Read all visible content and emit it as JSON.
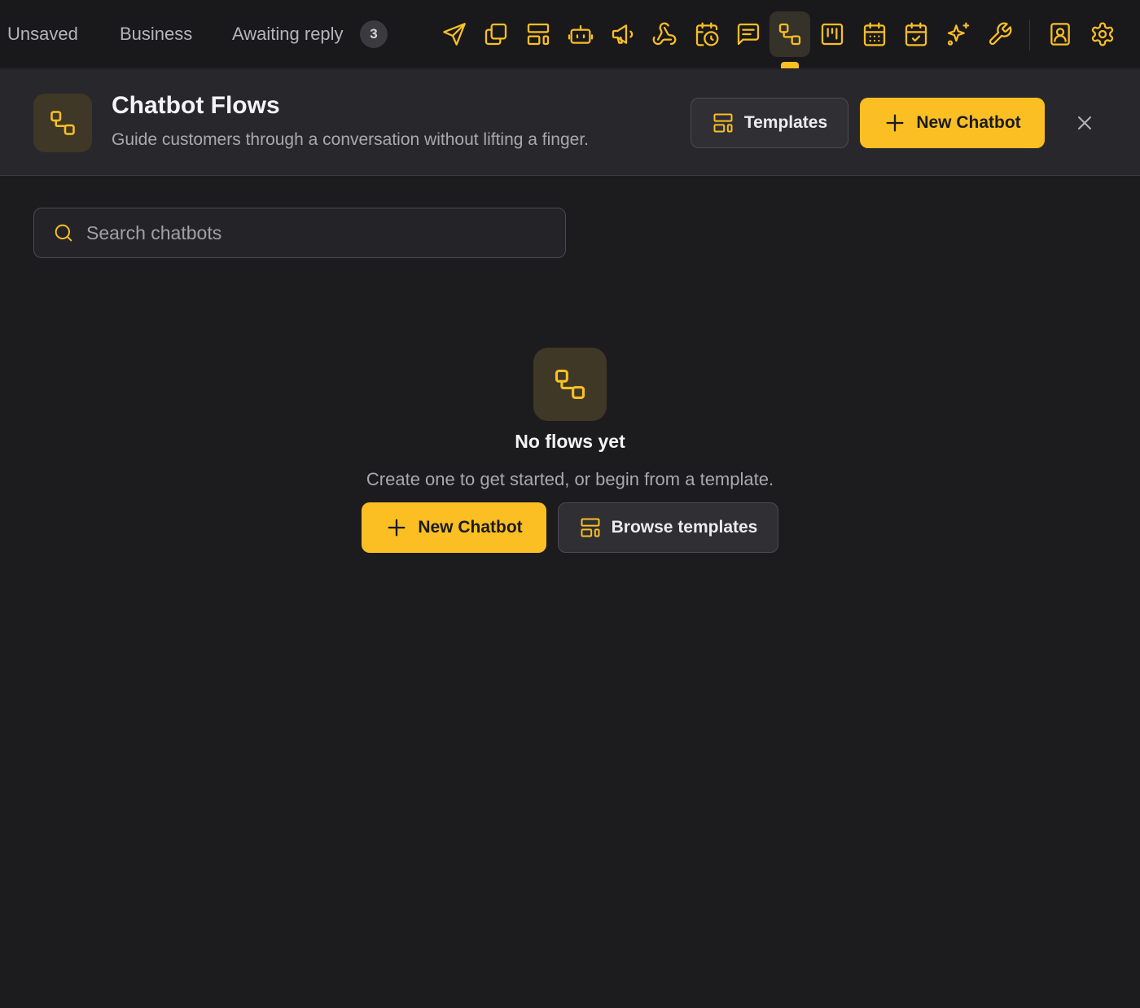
{
  "topbar": {
    "tabs": [
      {
        "label": "Unsaved"
      },
      {
        "label": "Business"
      },
      {
        "label": "Awaiting reply",
        "count": "3"
      }
    ],
    "tools": [
      {
        "icon": "send-icon"
      },
      {
        "icon": "copy-icon"
      },
      {
        "icon": "layout-icon"
      },
      {
        "icon": "bot-icon"
      },
      {
        "icon": "megaphone-icon"
      },
      {
        "icon": "webhook-icon"
      },
      {
        "icon": "calendar-clock-icon"
      },
      {
        "icon": "message-square-text-icon"
      },
      {
        "icon": "flows-icon",
        "active": true
      },
      {
        "icon": "kanban-icon"
      },
      {
        "icon": "calendar-grid-icon"
      },
      {
        "icon": "calendar-check-icon"
      },
      {
        "icon": "sparkles-icon"
      },
      {
        "icon": "wrench-icon"
      },
      {
        "icon": "contact-icon"
      },
      {
        "icon": "settings-gear-icon"
      }
    ]
  },
  "header": {
    "icon": "flows-icon",
    "title": "Chatbot Flows",
    "subtitle": "Guide customers through a conversation without lifting a finger.",
    "templates_label": "Templates",
    "new_chatbot_label": "New Chatbot",
    "close_icon": "close-icon"
  },
  "search": {
    "placeholder": "Search chatbots",
    "value": ""
  },
  "empty_state": {
    "icon": "flows-icon",
    "title": "No flows yet",
    "text": "Create one to get started, or begin from a template.",
    "new_chatbot_label": "New Chatbot",
    "browse_templates_label": "Browse templates"
  },
  "colors": {
    "accent": "#fbbf24",
    "background": "#1c1c1f",
    "header_background": "#28282c",
    "icon_tile": "#3f3826"
  }
}
